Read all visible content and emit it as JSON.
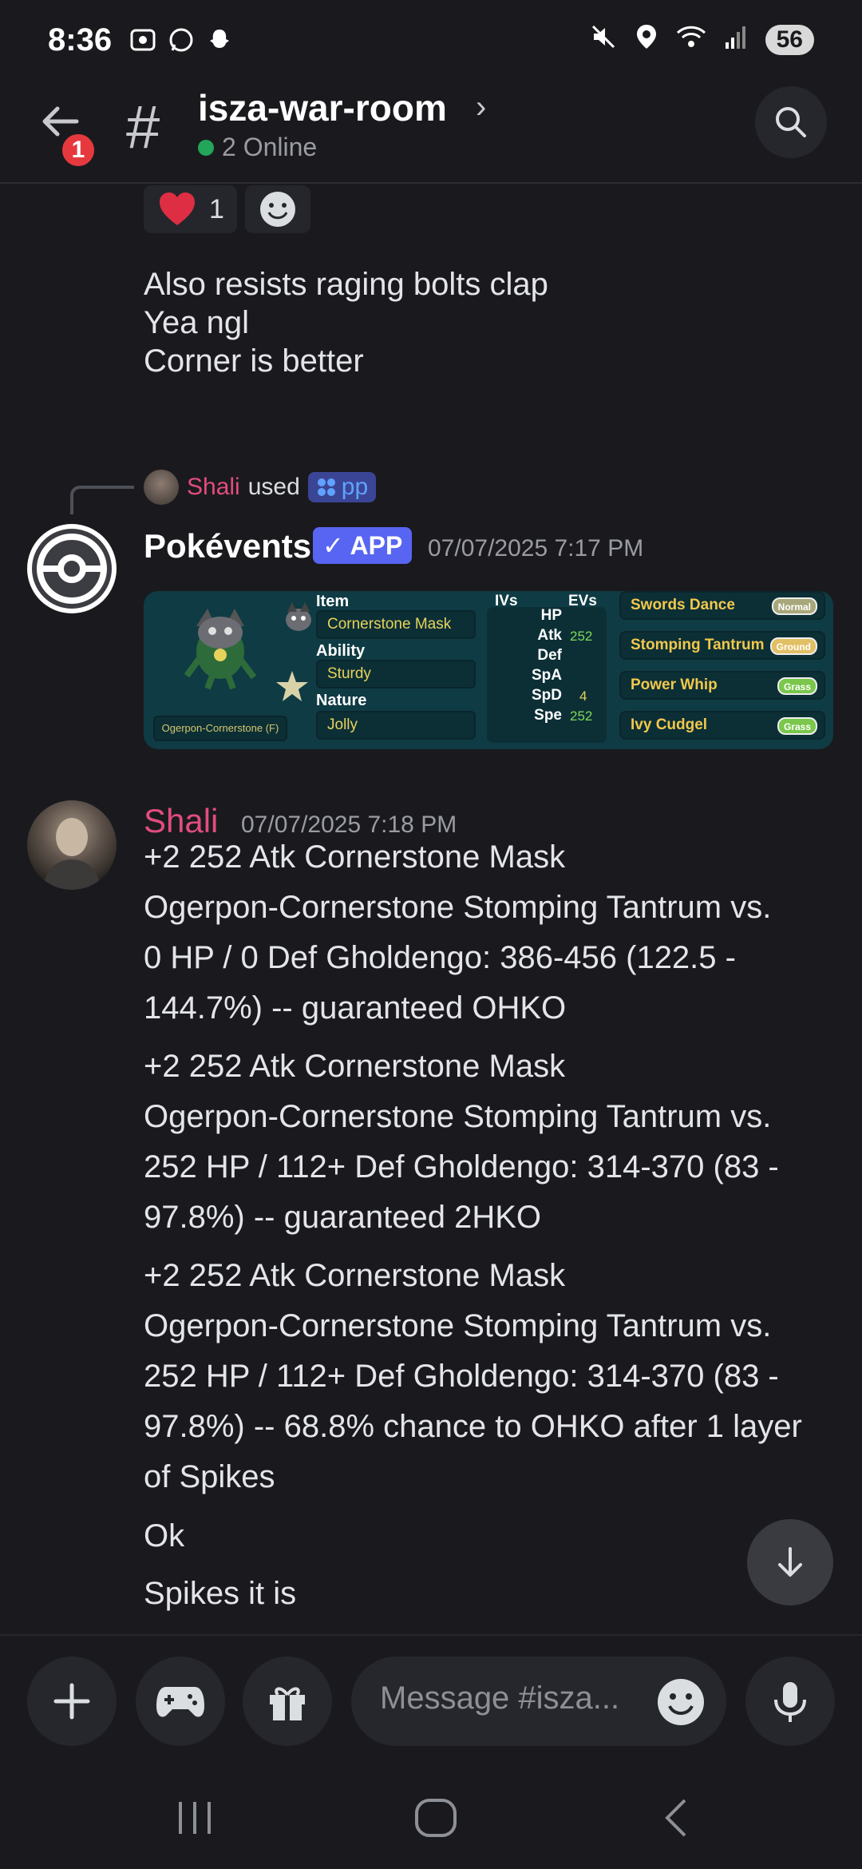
{
  "status_bar": {
    "time": "8:36",
    "battery": "56",
    "left_icons": [
      "screenshot-icon",
      "whatsapp-icon",
      "snapchat-icon"
    ],
    "right_icons": [
      "mute-icon",
      "location-icon",
      "wifi-icon",
      "signal-icon"
    ]
  },
  "header": {
    "notification_count": "1",
    "hash": "#",
    "channel_name": "isza-war-room",
    "chevron": "›",
    "online_text": "2 Online"
  },
  "reactions": [
    {
      "emoji": "heart",
      "count": "1"
    },
    {
      "emoji": "add-reaction",
      "count": ""
    }
  ],
  "messages_before": [
    "Also resists raging bolts clap",
    "Yea ngl",
    "Corner is better"
  ],
  "reply": {
    "user": "Shali",
    "used": "used",
    "command": "pp"
  },
  "bot_message": {
    "author": "Pokévents",
    "tag": "✓ APP",
    "timestamp": "07/07/2025 7:17 PM",
    "card": {
      "pokemon_name": "Ogerpon-Cornerstone (F)",
      "item_label": "Item",
      "item": "Cornerstone Mask",
      "ability_label": "Ability",
      "ability": "Sturdy",
      "nature_label": "Nature",
      "nature": "Jolly",
      "ivs_label": "IVs",
      "evs_label": "EVs",
      "stats": [
        {
          "name": "HP",
          "ev": ""
        },
        {
          "name": "Atk",
          "ev": "252"
        },
        {
          "name": "Def",
          "ev": ""
        },
        {
          "name": "SpA",
          "ev": ""
        },
        {
          "name": "SpD",
          "ev": "4"
        },
        {
          "name": "Spe",
          "ev": "252"
        }
      ],
      "moves": [
        {
          "name": "Swords Dance",
          "type": "Normal",
          "type_color": "#a8a77a"
        },
        {
          "name": "Stomping Tantrum",
          "type": "Ground",
          "type_color": "#e2bf65"
        },
        {
          "name": "Power Whip",
          "type": "Grass",
          "type_color": "#7ac74c"
        },
        {
          "name": "Ivy Cudgel",
          "type": "Grass",
          "type_color": "#7ac74c"
        }
      ]
    }
  },
  "shali_message": {
    "author": "Shali",
    "timestamp": "07/07/2025 7:18 PM",
    "paragraphs": [
      "+2 252 Atk Cornerstone Mask\nOgerpon-Cornerstone Stomping Tantrum vs.\n0 HP / 0 Def Gholdengo: 386-456 (122.5 -\n144.7%) -- guaranteed OHKO",
      "+2 252 Atk Cornerstone Mask\nOgerpon-Cornerstone Stomping Tantrum vs.\n252 HP / 112+ Def Gholdengo: 314-370 (83 -\n97.8%) -- guaranteed 2HKO",
      "+2 252 Atk Cornerstone Mask\nOgerpon-Cornerstone Stomping Tantrum vs.\n252 HP / 112+ Def Gholdengo: 314-370 (83 -\n97.8%) -- 68.8% chance to OHKO after 1 layer\nof Spikes",
      "Ok",
      "Spikes it is"
    ]
  },
  "composer": {
    "placeholder": "Message #isza..."
  },
  "colors": {
    "background": "#1a1a1e",
    "username_pink": "#e24c7e",
    "app_tag": "#5865f2",
    "online_green": "#23a55a",
    "badge_red": "#e5393e"
  }
}
